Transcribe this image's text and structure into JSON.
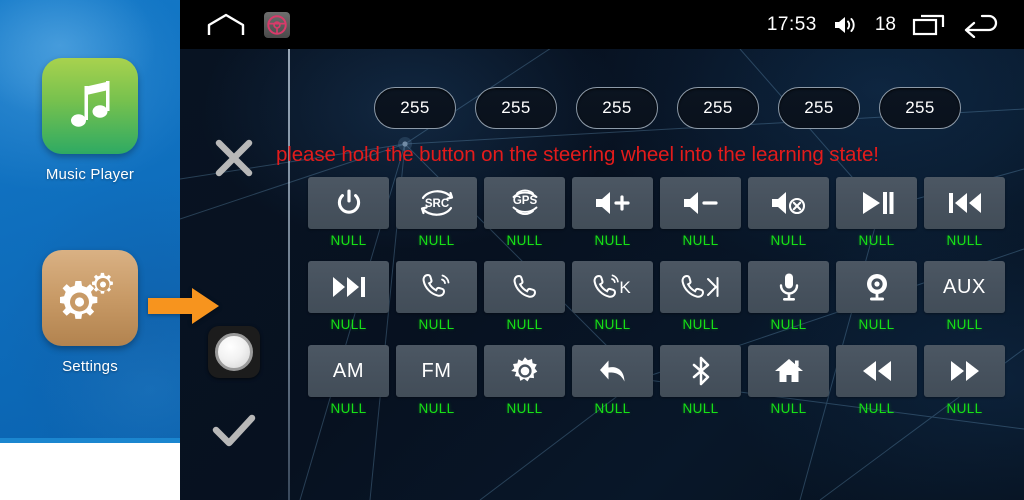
{
  "sidebar": {
    "apps": [
      {
        "label": "Music Player",
        "icon": "music-note-icon"
      },
      {
        "label": "Settings",
        "icon": "gears-icon"
      }
    ],
    "pointer_arrow": "orange-arrow-icon"
  },
  "statusbar": {
    "home_icon": "home-outline-icon",
    "app_icon": "steering-wheel-icon",
    "time": "17:53",
    "volume_icon": "speaker-icon",
    "volume_value": "18",
    "recents_icon": "recent-apps-icon",
    "back_icon": "back-arrow-icon"
  },
  "controls": {
    "cancel": {
      "name": "close-x-icon",
      "label": "X"
    },
    "learn": {
      "name": "learn-circle-button",
      "label": ""
    },
    "confirm": {
      "name": "check-icon",
      "label": ""
    }
  },
  "pills": {
    "values": [
      "255",
      "255",
      "255",
      "255",
      "255",
      "255"
    ]
  },
  "message": {
    "text": "please hold the button on the steering wheel into the learning state!",
    "color": "#e31b1b"
  },
  "grid": {
    "null_label": "NULL",
    "rows": [
      [
        {
          "icon": "power-icon",
          "text": "",
          "status": "NULL"
        },
        {
          "icon": "src-icon",
          "text": "",
          "status": "NULL"
        },
        {
          "icon": "gps-icon",
          "text": "",
          "status": "NULL"
        },
        {
          "icon": "volume-up-icon",
          "text": "",
          "status": "NULL"
        },
        {
          "icon": "volume-down-icon",
          "text": "",
          "status": "NULL"
        },
        {
          "icon": "mute-icon",
          "text": "",
          "status": "NULL"
        },
        {
          "icon": "play-pause-icon",
          "text": "",
          "status": "NULL"
        },
        {
          "icon": "previous-track-icon",
          "text": "",
          "status": "NULL"
        }
      ],
      [
        {
          "icon": "next-track-icon",
          "text": "",
          "status": "NULL"
        },
        {
          "icon": "phone-answer-icon",
          "text": "",
          "status": "NULL"
        },
        {
          "icon": "phone-hangup-icon",
          "text": "",
          "status": "NULL"
        },
        {
          "icon": "phone-call-key-icon",
          "text": "",
          "status": "NULL"
        },
        {
          "icon": "hangup-skip-icon",
          "text": "",
          "status": "NULL"
        },
        {
          "icon": "microphone-icon",
          "text": "",
          "status": "NULL"
        },
        {
          "icon": "camera-icon",
          "text": "",
          "status": "NULL"
        },
        {
          "icon": "aux-text",
          "text": "AUX",
          "status": "NULL"
        }
      ],
      [
        {
          "icon": "am-text",
          "text": "AM",
          "status": "NULL"
        },
        {
          "icon": "fm-text",
          "text": "FM",
          "status": "NULL"
        },
        {
          "icon": "settings-gear-icon",
          "text": "",
          "status": "NULL"
        },
        {
          "icon": "back-curve-icon",
          "text": "",
          "status": "NULL"
        },
        {
          "icon": "bluetooth-icon",
          "text": "",
          "status": "NULL"
        },
        {
          "icon": "home-icon",
          "text": "",
          "status": "NULL"
        },
        {
          "icon": "rewind-icon",
          "text": "",
          "status": "NULL"
        },
        {
          "icon": "fast-forward-icon",
          "text": "",
          "status": "NULL"
        }
      ]
    ]
  },
  "colors": {
    "sidebar_blue": "#0f6fbe",
    "panel_dark": "#071120",
    "tile_gray": "#46515d",
    "status_green": "#17e017",
    "warning_red": "#e31b1b",
    "arrow_orange": "#f7941e"
  }
}
